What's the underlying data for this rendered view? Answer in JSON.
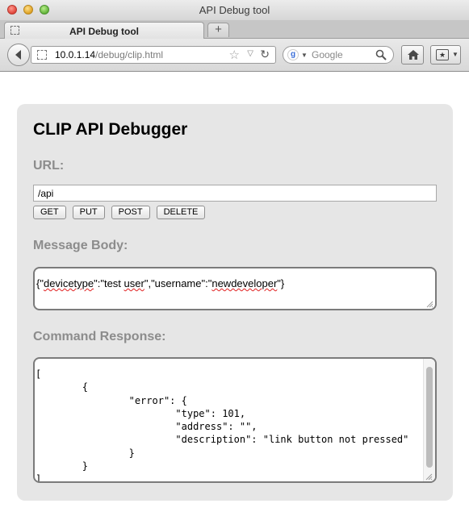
{
  "window": {
    "title": "API Debug tool"
  },
  "tab": {
    "label": "API Debug tool",
    "new_tab_label": "+"
  },
  "address_bar": {
    "host": "10.0.1.14",
    "path": "/debug/clip.html"
  },
  "search": {
    "placeholder": "Google",
    "engine_icon": "google-icon"
  },
  "icons": {
    "back": "back-arrow-icon",
    "reload": "reload-icon",
    "bookmark_star": "star-icon",
    "home": "home-icon",
    "bookmarks": "bookmarks-icon"
  },
  "page": {
    "title": "CLIP API Debugger",
    "url_label": "URL:",
    "url_value": "/api",
    "methods": [
      "GET",
      "PUT",
      "POST",
      "DELETE"
    ],
    "message_body_label": "Message Body:",
    "message_body": {
      "segments": [
        "{\"",
        "devicetype",
        "\":\"test ",
        "user",
        "\",\"username\":\"",
        "newdeveloper",
        "\"}"
      ]
    },
    "command_response_label": "Command Response:",
    "command_response": "[\n\t{\n\t\t\"error\": {\n\t\t\t\"type\": 101,\n\t\t\t\"address\": \"\",\n\t\t\t\"description\": \"link button not pressed\"\n\t\t}\n\t}\n]"
  },
  "colors": {
    "panel_background": "#e6e6e6",
    "section_label": "#8c8c8c",
    "spellcheck_underline": "#e02020"
  }
}
